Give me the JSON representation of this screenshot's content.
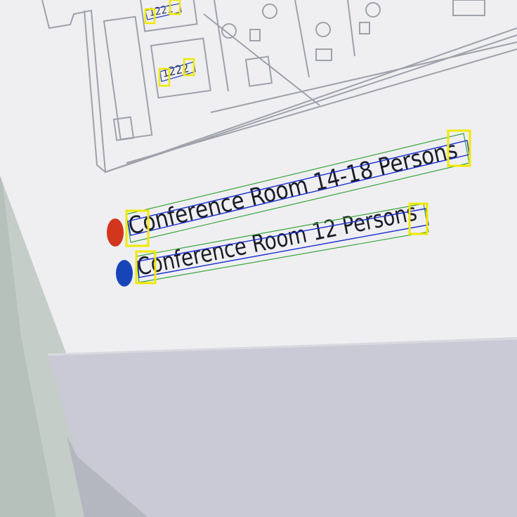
{
  "scene": {
    "description_visible": false,
    "colors": {
      "wall": "#c7d0cc",
      "board": "#f1f1f3",
      "board_shadow": "#dcdce2",
      "bottom_panel": "#cbccd6",
      "plan_line": "#9da0a8",
      "text": "#1a1c26",
      "red_dot": "#d2361d",
      "blue_dot": "#1745b8",
      "bbox_green": "#3aa63a",
      "bbox_blue": "#1b2fcf",
      "bbox_yellow": "#f0e800"
    }
  },
  "floorplan": {
    "room_labels": [
      "1221",
      "1222"
    ]
  },
  "legend": {
    "items": [
      {
        "color_key": "red_dot",
        "label": "Conference Room 14-18 Persons"
      },
      {
        "color_key": "blue_dot",
        "label": "Conference Room 12 Persons"
      }
    ]
  }
}
